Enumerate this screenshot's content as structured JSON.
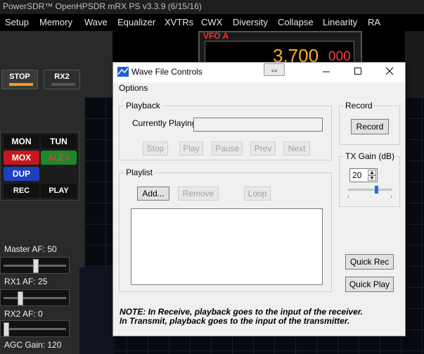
{
  "app": {
    "title": "PowerSDR™ OpenHPSDR mRX PS v3.3.9 (6/15/16)",
    "menu": [
      "Setup",
      "Memory",
      "Wave",
      "Equalizer",
      "XVTRs",
      "CWX",
      "Diversity",
      "Collapse",
      "Linearity",
      "RA"
    ],
    "vfo_a": {
      "label": "VFO A",
      "freq_main": "3.700",
      "freq_sub": "000"
    },
    "stop_label": "STOP",
    "rx2_label": "RX2",
    "buttons": {
      "mon": "MON",
      "tun": "TUN",
      "mox": "MOX",
      "alex": "ALEX",
      "dup": "DUP",
      "rec": "REC",
      "play": "PLAY"
    },
    "sliders": {
      "master_af": {
        "label": "Master AF:  50",
        "level": 0.5
      },
      "rx1_af": {
        "label": "RX1 AF:  25",
        "level": 0.25
      },
      "rx2_af": {
        "label": "RX2 AF:  0",
        "level": 0.0
      },
      "agc_gain": {
        "label": "AGC Gain:  120"
      }
    },
    "colors": {
      "mox_red": "#c8161e",
      "alex_green": "#1a8a2a",
      "dup_blue": "#1f3fbf",
      "led_orange": "#ff9a1a"
    }
  },
  "dialog": {
    "title": "Wave File Controls",
    "move_icon": "⇔",
    "menu": {
      "options": "Options"
    },
    "playback": {
      "group_label": "Playback",
      "currently_playing_label": "Currently Playing",
      "currently_playing_value": "",
      "buttons": {
        "stop": "Stop",
        "play": "Play",
        "pause": "Pause",
        "prev": "Prev",
        "next": "Next"
      }
    },
    "record": {
      "group_label": "Record",
      "button": "Record"
    },
    "tx_gain": {
      "group_label": "TX Gain (dB)",
      "value": "20",
      "level": 0.65
    },
    "playlist": {
      "group_label": "Playlist",
      "buttons": {
        "add": "Add...",
        "remove": "Remove",
        "loop": "Loop"
      },
      "items": []
    },
    "quick_rec": "Quick Rec",
    "quick_play": "Quick Play",
    "note_line1": "NOTE: In Receive, playback goes to the input of the receiver.",
    "note_line2": "In Transmit, playback goes to the input of the transmitter."
  }
}
